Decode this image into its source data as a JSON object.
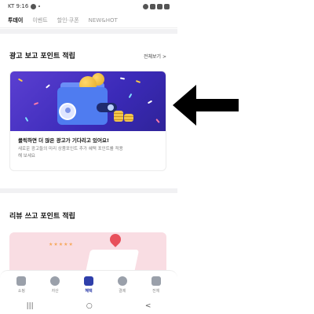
{
  "status_bar": {
    "carrier_time": "KT 9:16"
  },
  "tabs": [
    "투데이",
    "이벤트",
    "할인·쿠폰",
    "NEW&HOT"
  ],
  "section1": {
    "title": "광고 보고 포인트 적립",
    "see_all": "전체보기 >"
  },
  "ad_card": {
    "title": "클릭하면 더 많은 광고가 기다리고 있어요!",
    "desc_line1": "새로운 광고들의 미리 상품포인트 추가 혜택 포인트를 적용",
    "desc_line2": "해 보세요"
  },
  "section2": {
    "title": "리뷰 쓰고 포인트 적립"
  },
  "review_card": {
    "stars": "★★★★★"
  },
  "bottom_nav": [
    {
      "label": "쇼핑",
      "icon": "wallet-icon"
    },
    {
      "label": "자산",
      "icon": "pie-chart-icon"
    },
    {
      "label": "혜택",
      "icon": "benefit-icon"
    },
    {
      "label": "결제",
      "icon": "payment-icon"
    },
    {
      "label": "전체",
      "icon": "menu-icon"
    }
  ],
  "system_nav": {
    "recent": "|||",
    "home": "○",
    "back": "<"
  },
  "colors": {
    "accent": "#2f3faa",
    "banner": "#4a33c6",
    "arrow": "#000000"
  }
}
